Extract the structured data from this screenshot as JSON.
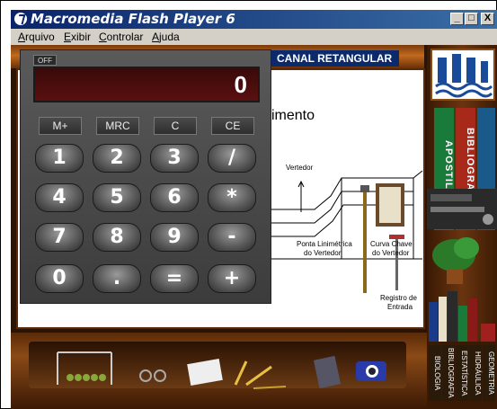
{
  "window": {
    "title": "Macromedia Flash Player 6",
    "minimize": "_",
    "maximize": "□",
    "close": "X"
  },
  "menu": [
    "Arquivo",
    "Exibir",
    "Controlar",
    "Ajuda"
  ],
  "banner": {
    "label": "CANAL RETANGULAR"
  },
  "content": {
    "heading": "imento",
    "labels": {
      "vertedor": "Vertedor",
      "ponta1": "Ponta Linimétrica",
      "ponta2": "do Vertedor",
      "curva1": "Curva Chave",
      "curva2": "do Vertedor",
      "registro1": "Registro de",
      "registro2": "Entrada"
    }
  },
  "shelf": {
    "book_apostila": "APOSTILA",
    "book_bibliografia": "BIBLIOGRAFIA",
    "small_books": [
      "HIDRÁULICA",
      "BIBLIOGRAFIA",
      "ESTATÍSTICA",
      "GEOMETRIA",
      "BIOLOGIA"
    ]
  },
  "calculator": {
    "off_label": "OFF",
    "display": "0",
    "memory_keys": [
      "M+",
      "MRC",
      "C",
      "CE"
    ],
    "keys": [
      [
        "1",
        "2",
        "3",
        "/"
      ],
      [
        "4",
        "5",
        "6",
        "*"
      ],
      [
        "7",
        "8",
        "9",
        "-"
      ],
      [
        "0",
        ".",
        "=",
        "+"
      ]
    ]
  },
  "colors": {
    "title_bar": "#0a246a",
    "banner": "#0b2a6e",
    "display": "#4a0c0c"
  }
}
